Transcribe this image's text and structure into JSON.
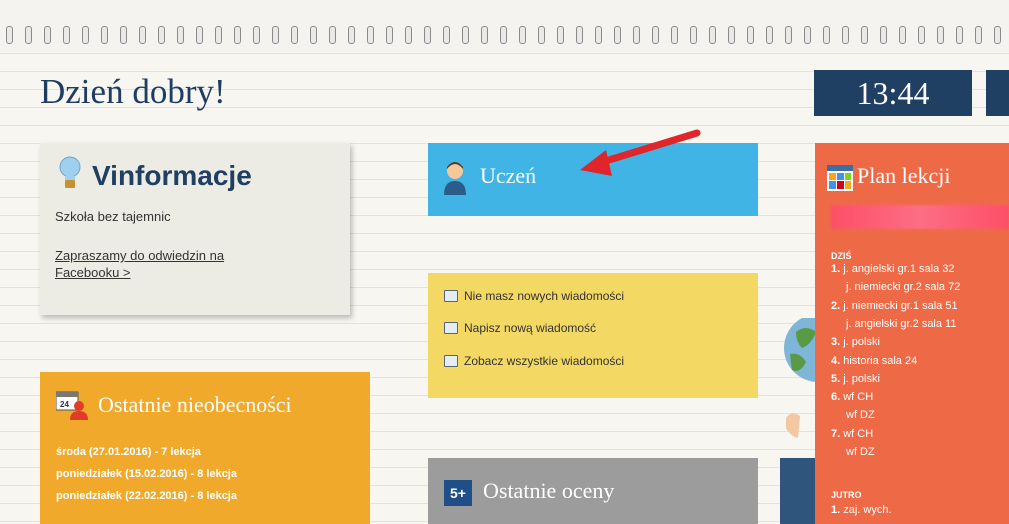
{
  "header": {
    "greeting": "Dzień dobry!",
    "clock": "13:44"
  },
  "vinformacje": {
    "title": "Vinformacje",
    "subtitle": "Szkoła bez tajemnic",
    "link_text": "Zapraszamy do odwiedzin na Facebooku >"
  },
  "uczen": {
    "label": "Uczeń"
  },
  "messages": {
    "items": [
      "Nie masz nowych wiadomości",
      "Napisz nową wiadomość",
      "Zobacz wszystkie wiadomości"
    ]
  },
  "absences": {
    "title": "Ostatnie nieobecności",
    "items": [
      "środa (27.01.2016) - 7 lekcja",
      "poniedziałek (15.02.2016) - 8 lekcja",
      "poniedziałek (22.02.2016) - 8 lekcja"
    ]
  },
  "grades": {
    "title": "Ostatnie oceny",
    "icon_text": "5+"
  },
  "plan": {
    "title": "Plan lekcji",
    "today_label": "DZIŚ",
    "today": [
      {
        "num": "1.",
        "text": "j. angielski gr.1 sala 32"
      },
      {
        "num": "",
        "text": "j. niemiecki gr.2 sala 72"
      },
      {
        "num": "2.",
        "text": "j. niemiecki gr.1 sala 51"
      },
      {
        "num": "",
        "text": "j. angielski gr.2 sala 11"
      },
      {
        "num": "3.",
        "text": "j. polski"
      },
      {
        "num": "4.",
        "text": "historia sala 24"
      },
      {
        "num": "5.",
        "text": "j. polski"
      },
      {
        "num": "6.",
        "text": "wf CH"
      },
      {
        "num": "",
        "text": "wf DZ"
      },
      {
        "num": "7.",
        "text": "wf CH"
      },
      {
        "num": "",
        "text": "wf DZ"
      }
    ],
    "tomorrow_label": "JUTRO",
    "tomorrow": [
      {
        "num": "1.",
        "text": "zaj. wych."
      }
    ]
  },
  "colors": {
    "navy": "#1f3f63",
    "blue_tile": "#3fb4e5",
    "yellow_tile": "#f3d863",
    "orange_tile": "#f0a92b",
    "grey_tile": "#9c9c9c",
    "red_tile": "#ee6a47",
    "arrow": "#e0262b"
  }
}
